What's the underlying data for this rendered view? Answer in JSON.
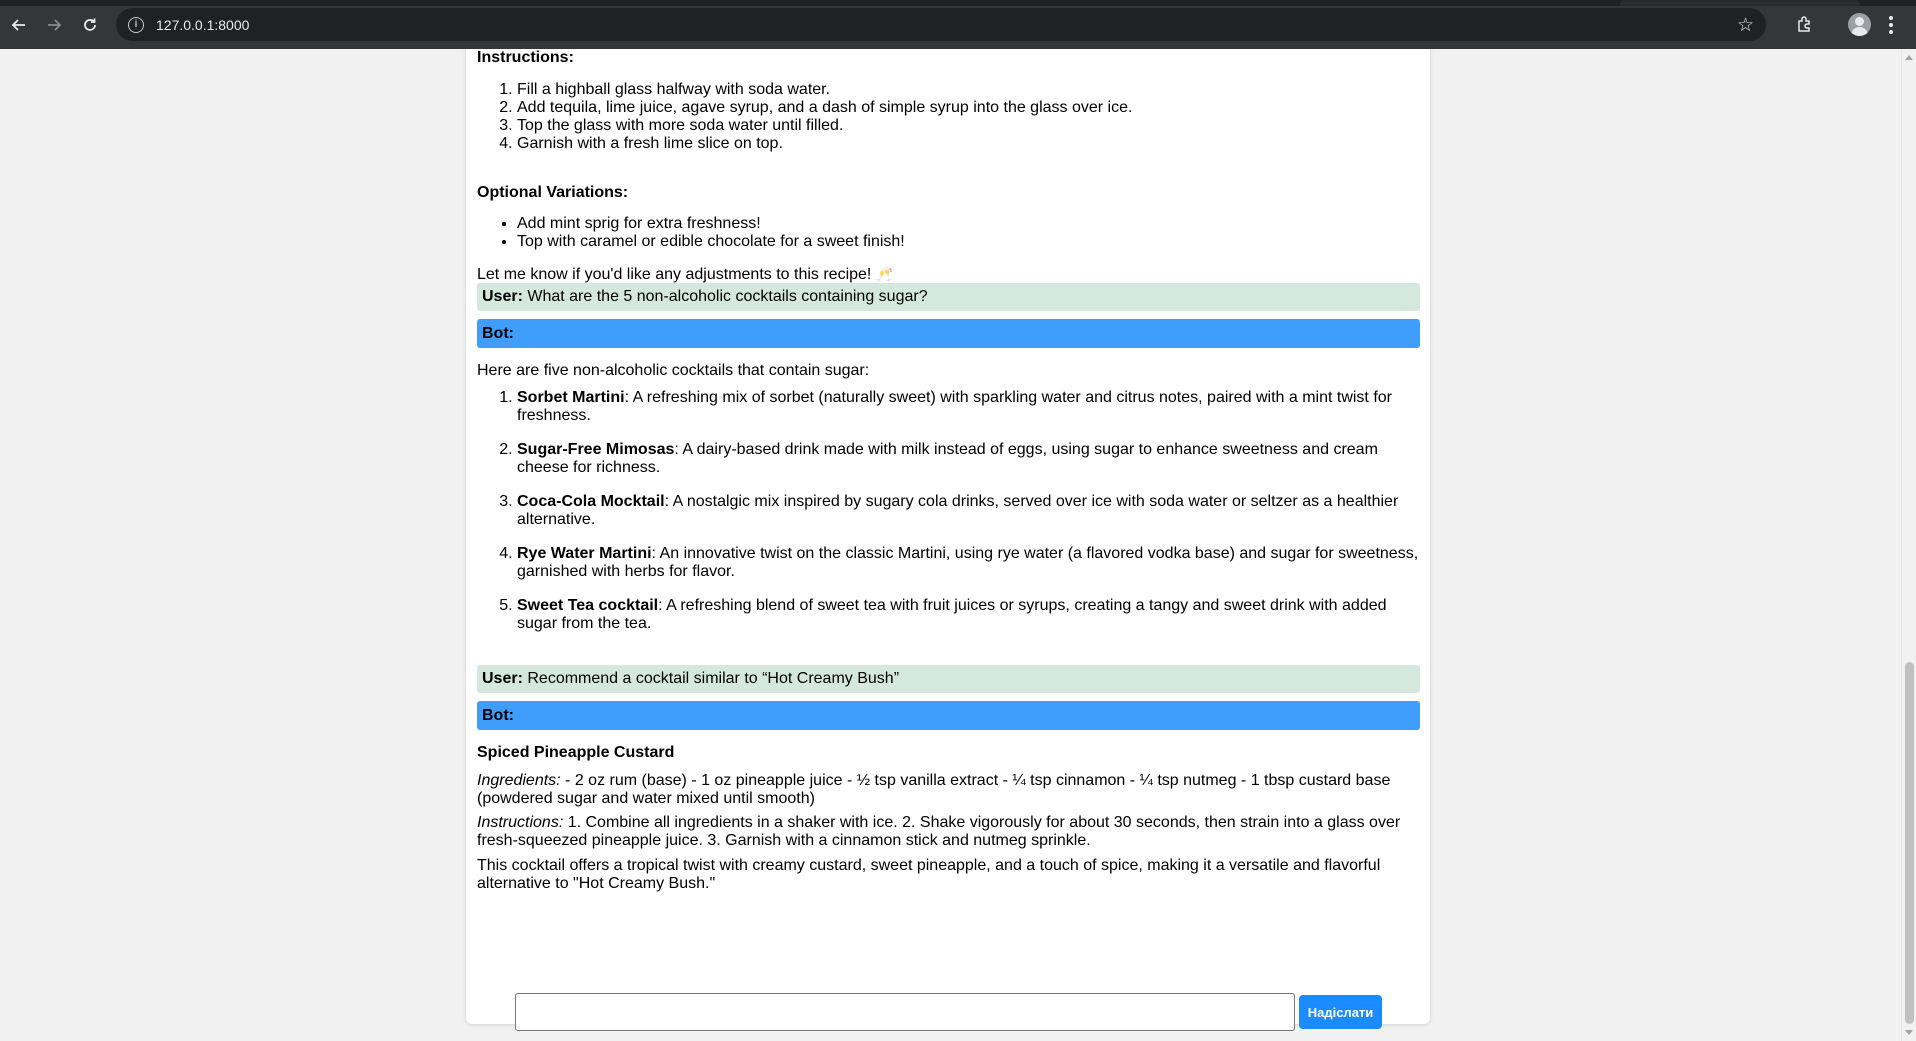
{
  "browser": {
    "url": "127.0.0.1:8000"
  },
  "chat": {
    "recipe_tail": {
      "instructions_heading": "Instructions:",
      "steps": [
        "Fill a highball glass halfway with soda water.",
        "Add tequila, lime juice, agave syrup, and a dash of simple syrup into the glass over ice.",
        "Top the glass with more soda water until filled.",
        "Garnish with a fresh lime slice on top."
      ],
      "variations_heading": "Optional Variations:",
      "variations": [
        "Add mint sprig for extra freshness!",
        "Top with caramel or edible chocolate for a sweet finish!"
      ],
      "closing": "Let me know if you'd like any adjustments to this recipe!",
      "closing_emoji": "🥂"
    },
    "user_label": "User:",
    "bot_label": "Bot:",
    "user_msg_1": "What are the 5 non-alcoholic cocktails containing sugar?",
    "bot_msg_1": {
      "intro": "Here are five non-alcoholic cocktails that contain sugar:",
      "items": [
        {
          "name": "Sorbet Martini",
          "desc": ": A refreshing mix of sorbet (naturally sweet) with sparkling water and citrus notes, paired with a mint twist for freshness."
        },
        {
          "name": "Sugar-Free Mimosas",
          "desc": ": A dairy-based drink made with milk instead of eggs, using sugar to enhance sweetness and cream cheese for richness."
        },
        {
          "name": "Coca-Cola Mocktail",
          "desc": ": A nostalgic mix inspired by sugary cola drinks, served over ice with soda water or seltzer as a healthier alternative."
        },
        {
          "name": "Rye Water Martini",
          "desc": ": An innovative twist on the classic Martini, using rye water (a flavored vodka base) and sugar for sweetness, garnished with herbs for flavor."
        },
        {
          "name": "Sweet Tea cocktail",
          "desc": ": A refreshing blend of sweet tea with fruit juices or syrups, creating a tangy and sweet drink with added sugar from the tea."
        }
      ]
    },
    "user_msg_2": "Recommend a cocktail similar to “Hot Creamy Bush”",
    "bot_msg_2": {
      "title": "Spiced Pineapple Custard",
      "ingredients_label": "Ingredients:",
      "ingredients": " - 2 oz rum (base) - 1 oz pineapple juice - ½ tsp vanilla extract - ¼ tsp cinnamon - ¼ tsp nutmeg - 1 tbsp custard base (powdered sugar and water mixed until smooth)",
      "instructions_label": "Instructions:",
      "instructions": " 1. Combine all ingredients in a shaker with ice. 2. Shake vigorously for about 30 seconds, then strain into a glass over fresh-squeezed pineapple juice. 3. Garnish with a cinnamon stick and nutmeg sprinkle.",
      "closing": "This cocktail offers a tropical twist with creamy custard, sweet pineapple, and a touch of spice, making it a versatile and flavorful alternative to \"Hot Creamy Bush.\""
    }
  },
  "composer": {
    "value": "",
    "send_label": "Надіслати"
  },
  "colors": {
    "user_bg": "#d4e8de",
    "bot_bg": "#3f9efc",
    "send_bg": "#1a8cff"
  }
}
